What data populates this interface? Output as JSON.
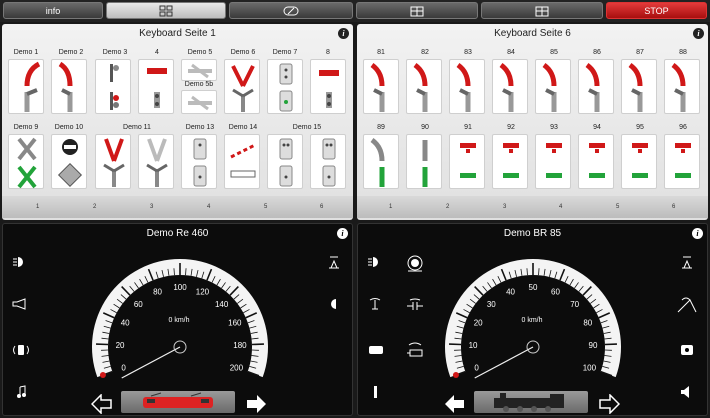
{
  "toolbar": {
    "info_label": "info",
    "stop_label": "STOP",
    "tab_icons": [
      "keyboard-icon",
      "control-icon",
      "layout-icon",
      "layout2-icon"
    ]
  },
  "keyboard_left": {
    "title": "Keyboard Seite 1",
    "row1_labels": [
      "Demo 1",
      "Demo 2",
      "Demo 3",
      "4",
      "Demo 5",
      "Demo 6",
      "Demo 7",
      "8"
    ],
    "demo5b_label": "Demo 5b",
    "row2_labels": [
      "Demo 9",
      "Demo 10",
      "Demo 11",
      "Demo 13",
      "Demo 14",
      "Demo 15"
    ],
    "pages": [
      "1",
      "2",
      "3",
      "4",
      "5",
      "6"
    ]
  },
  "keyboard_right": {
    "title": "Keyboard Seite 6",
    "row1_labels": [
      "81",
      "82",
      "83",
      "84",
      "85",
      "86",
      "87",
      "88"
    ],
    "row2_labels": [
      "89",
      "90",
      "91",
      "92",
      "93",
      "94",
      "95",
      "96"
    ],
    "pages": [
      "1",
      "2",
      "3",
      "4",
      "5",
      "6"
    ]
  },
  "cab_left": {
    "title": "Demo Re 460",
    "speed_label": "0 km/h",
    "ticks": [
      "0",
      "20",
      "40",
      "60",
      "80",
      "100",
      "120",
      "140",
      "160",
      "180",
      "200"
    ]
  },
  "cab_right": {
    "title": "Demo BR 85",
    "speed_label": "0 km/h",
    "ticks": [
      "0",
      "10",
      "20",
      "30",
      "40",
      "50",
      "60",
      "70",
      "80",
      "90",
      "100"
    ]
  },
  "colors": {
    "accent_red": "#d01818",
    "signal_green": "#22a33a",
    "stop": "#c41616"
  }
}
